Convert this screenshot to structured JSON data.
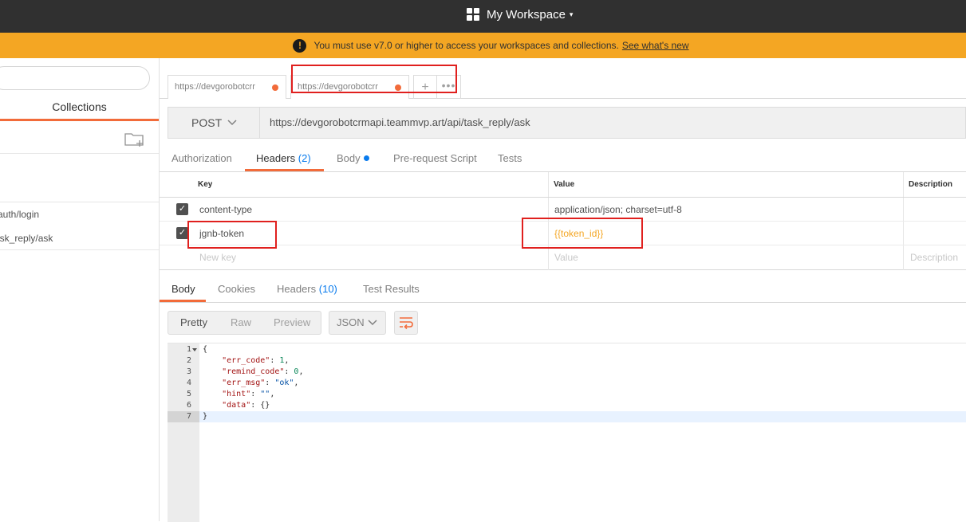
{
  "topbar": {
    "workspace_label": "My Workspace",
    "caret": "▾"
  },
  "banner": {
    "message": "You must use v7.0 or higher to access your workspaces and collections.",
    "link_text": "See what's new",
    "warning_glyph": "!"
  },
  "sidebar": {
    "tab_label": "Collections",
    "items": [
      {
        "label": "auth/login"
      },
      {
        "label": "ask_reply/ask"
      }
    ]
  },
  "request_tabs": [
    {
      "label": "https://devgorobotcrr"
    },
    {
      "label": "https://devgorobotcrr"
    }
  ],
  "tabstrip": {
    "new_tab": "+",
    "more": "•••"
  },
  "request": {
    "method": "POST",
    "url": "https://devgorobotcrmapi.teammvp.art/api/task_reply/ask"
  },
  "req_tabs": {
    "authorization": "Authorization",
    "headers": "Headers",
    "headers_count": "(2)",
    "body": "Body",
    "pre_request": "Pre-request Script",
    "tests": "Tests"
  },
  "headers_table": {
    "col_key": "Key",
    "col_value": "Value",
    "col_description": "Description",
    "rows": [
      {
        "checked": true,
        "key": "content-type",
        "value": "application/json; charset=utf-8"
      },
      {
        "checked": true,
        "key": "jgnb-token",
        "value": "{{token_id}}"
      }
    ],
    "new_key_placeholder": "New key",
    "new_value_placeholder": "Value",
    "new_description_placeholder": "Description"
  },
  "resp_tabs": {
    "body": "Body",
    "cookies": "Cookies",
    "headers": "Headers",
    "headers_count": "(10)",
    "test_results": "Test Results"
  },
  "format": {
    "pretty": "Pretty",
    "raw": "Raw",
    "preview": "Preview",
    "lang": "JSON"
  },
  "response_lines": [
    {
      "num": "1",
      "text": "{"
    },
    {
      "num": "2",
      "key": "\"err_code\"",
      "value": "1",
      "type": "n",
      "comma": ","
    },
    {
      "num": "3",
      "key": "\"remind_code\"",
      "value": "0",
      "type": "n",
      "comma": ","
    },
    {
      "num": "4",
      "key": "\"err_msg\"",
      "value": "\"ok\"",
      "type": "s",
      "comma": ","
    },
    {
      "num": "5",
      "key": "\"hint\"",
      "value": "\"\"",
      "type": "s",
      "comma": ","
    },
    {
      "num": "6",
      "key": "\"data\"",
      "value": "{}",
      "type": "p",
      "comma": ""
    },
    {
      "num": "7",
      "text": "}"
    }
  ],
  "colors": {
    "accent": "#f26b3a",
    "banner": "#f4a623",
    "topbar": "#303030",
    "count_blue": "#097bed",
    "annotation_red": "#e0201e"
  }
}
